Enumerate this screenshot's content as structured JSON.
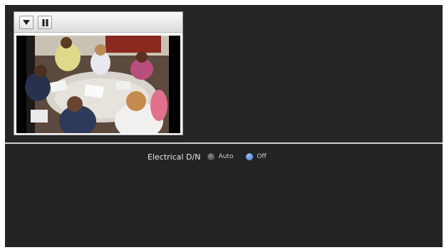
{
  "viewer": {
    "toolbar": {
      "menu_icon": "triangle-down-icon",
      "pause_icon": "pause-icon"
    },
    "video": {
      "content": "video-feed"
    }
  },
  "settings": {
    "electrical_dn": {
      "label": "Electrical D/N",
      "options": [
        {
          "label": "Auto",
          "selected": false
        },
        {
          "label": "Off",
          "selected": true
        }
      ]
    }
  },
  "colors": {
    "background": "#252525",
    "divider": "#cfcfcf",
    "radio_selected": "#3f72d4",
    "radio_unselected": "#5a5a5a"
  }
}
